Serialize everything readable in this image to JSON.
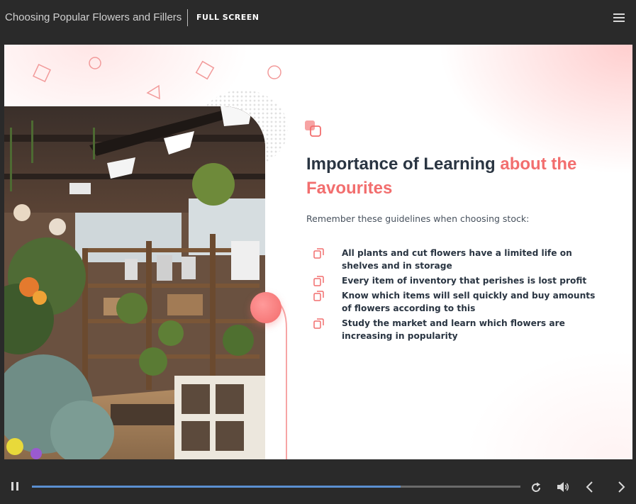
{
  "header": {
    "course_title": "Choosing Popular Flowers and Fillers",
    "fullscreen_label": "FULL SCREEN"
  },
  "slide": {
    "heading_plain": "Importance of Learning ",
    "heading_accent": "about the Favourites",
    "intro": "Remember these guidelines when choosing stock:",
    "bullets": [
      "All plants and cut flowers have a limited life on shelves and in storage",
      "Every item of inventory that perishes is lost profit",
      "Know which items will sell quickly and buy amounts of flowers according to this",
      "Study the market and learn which flowers are increasing in popularity"
    ],
    "image": "flower-shop-photo"
  },
  "player": {
    "progress": 0.755,
    "icons": [
      "pause-icon",
      "replay-icon",
      "volume-icon",
      "previous-icon",
      "next-icon",
      "menu-icon"
    ]
  },
  "colors": {
    "accent": "#f26e6e",
    "heading": "#2a3542",
    "progress": "#5b8fd0",
    "chrome": "#2a2a2a"
  }
}
